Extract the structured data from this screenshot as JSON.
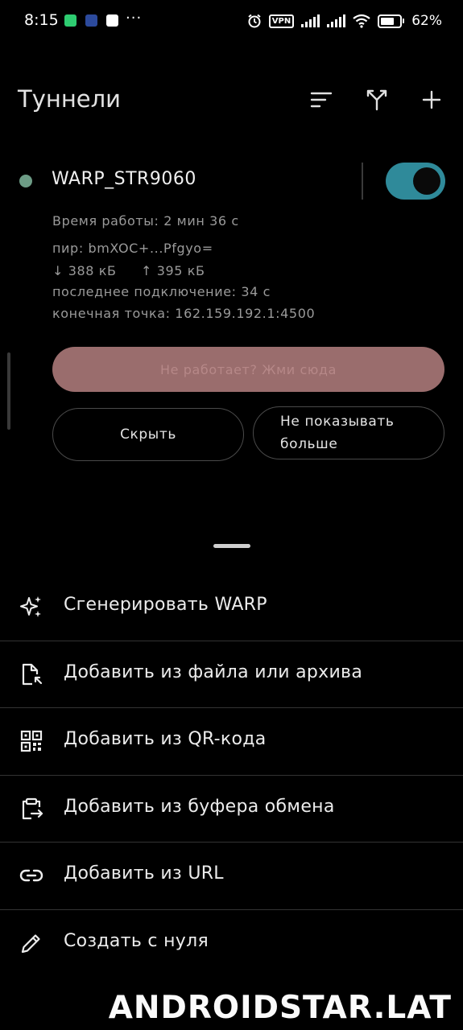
{
  "status_bar": {
    "time": "8:15",
    "icons_left": [
      "whatsapp-icon",
      "app-icon",
      "app-icon",
      "more-dots-icon"
    ],
    "dots": "···",
    "vpn": "VPN",
    "battery_percent": "62%",
    "battery_level": 0.62
  },
  "header": {
    "title": "Туннели",
    "icons": [
      "sort-icon",
      "split-tunnel-icon",
      "add-icon"
    ]
  },
  "tunnel": {
    "name": "WARP_STR9060",
    "status_color": "#6d9c86",
    "toggle_on": true,
    "toggle_color": "#2f8a9a",
    "uptime": "Время работы: 2 мин 36 с",
    "peer": "пир: bmXOC+...Pfgyo=",
    "rx": "↓ 388 кБ",
    "tx": "↑ 395 кБ",
    "last_handshake": "последнее подключение: 34 с",
    "endpoint": "конечная точка: 162.159.192.1:4500",
    "help_button": "Не работает? Жми сюда",
    "hide_button": "Скрыть",
    "dont_show_line1": "Не показывать",
    "dont_show_line2": "больше"
  },
  "menu": {
    "items": [
      {
        "label": "Сгенерировать WARP",
        "icon": "sparkle-icon"
      },
      {
        "label": "Добавить из файла или архива",
        "icon": "file-import-icon"
      },
      {
        "label": "Добавить из QR-кода",
        "icon": "qr-code-icon"
      },
      {
        "label": "Добавить из буфера обмена",
        "icon": "clipboard-icon"
      },
      {
        "label": "Добавить из URL",
        "icon": "link-icon"
      },
      {
        "label": "Создать с нуля",
        "icon": "pencil-icon"
      }
    ]
  },
  "watermark": "ANDROIDSTAR.LAT"
}
